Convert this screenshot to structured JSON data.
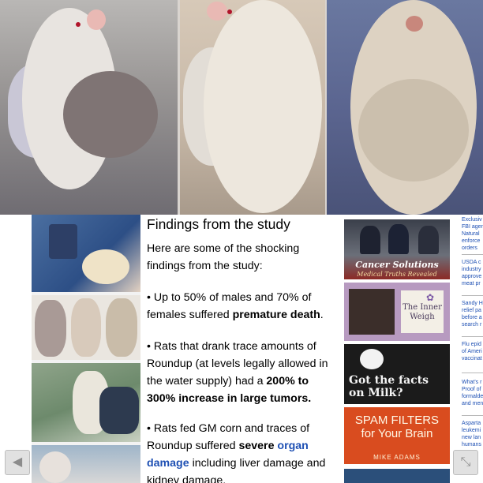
{
  "hero": {
    "photos": [
      {
        "name": "rat-tumor-photo-1"
      },
      {
        "name": "rat-tumor-photo-2"
      },
      {
        "name": "rat-tumor-photo-3"
      }
    ]
  },
  "article": {
    "title": "Findings from the study",
    "intro": "Here are some of the shocking findings from the study:",
    "bullet1_prefix": "• Up to 50% of males and 70% of females suffered ",
    "bullet1_bold": "premature death",
    "bullet1_suffix": ".",
    "bullet2_prefix": "• Rats that drank trace amounts of Roundup (at levels legally allowed in the water supply) had a ",
    "bullet2_bold": "200% to 300% increase in large tumors.",
    "bullet3_prefix": "• Rats fed GM corn and traces of Roundup suffered ",
    "bullet3_bold": "severe ",
    "bullet3_link": "organ damage",
    "bullet3_suffix": " including liver damage and kidney damage."
  },
  "ads": {
    "ad1_title": "Cancer Solutions",
    "ad1_sub": "Medical Truths Revealed",
    "ad2_title": "The Inner Weigh",
    "ad3_title": "Got the facts on Milk?",
    "ad4_title": "SPAM FILTERS for Your Brain",
    "ad4_author": "MIKE ADAMS"
  },
  "news": [
    {
      "text": "Exclusiv\nFBI agen\nNatural\nenforce\norders"
    },
    {
      "text": "USDA c\nindustry\napprove\nmeat pr"
    },
    {
      "text": "Sandy H\nrelief pa\nbefore a\nsearch r"
    },
    {
      "text": "Flu epid\nof Ameri\nvaccinat"
    },
    {
      "text": "What's r\nProof of\nformalde\nand men"
    },
    {
      "text": "Aspartа\nleukemi\nnew lan\nhumans"
    }
  ],
  "nav": {
    "prev_icon": "◀",
    "expand_icon": "⤡"
  }
}
